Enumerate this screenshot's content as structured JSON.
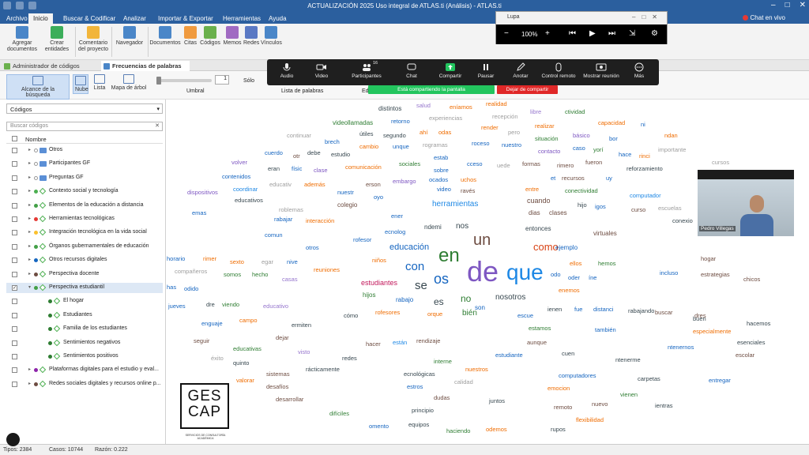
{
  "window": {
    "title": "ACTUALIZACIÓN 2025 Uso integral de ATLAS.ti (Análisis) - ATLAS.ti",
    "live_chat": "Chat en vivo"
  },
  "ribbon_tabs": [
    {
      "label": "Archivo"
    },
    {
      "label": "Inicio"
    },
    {
      "label": "Buscar & Codificar"
    },
    {
      "label": "Analizar"
    },
    {
      "label": "Importar & Exportar"
    },
    {
      "label": "Herramientas"
    },
    {
      "label": "Ayuda"
    }
  ],
  "ribbon": {
    "add_docs": "Agregar documentos",
    "create_entities": "Crear entidades",
    "project_comment": "Comentario del proyecto",
    "navigator": "Navegador",
    "documents": "Documentos",
    "quotes": "Citas",
    "codes": "Códigos",
    "memos": "Memos",
    "networks": "Redes",
    "links": "Vínculos"
  },
  "doc_tabs": [
    {
      "label": "Administrador de códigos"
    },
    {
      "label": "Frecuencias de palabras"
    }
  ],
  "subtoolbar": {
    "search_scope": "Alcance de la búsqueda",
    "cloud": "Nube",
    "list": "Lista",
    "tree_map": "Mapa de árbol",
    "threshold": "Umbral",
    "threshold_value": "1",
    "only": "Sólo",
    "word_list": "Lista de palabras",
    "partial_ed": "Ed"
  },
  "left_panel": {
    "dropdown": "Códigos",
    "search_placeholder": "Buscar códigos",
    "column_name": "Nombre",
    "items": [
      {
        "label": "Otros",
        "kind": "folder",
        "indent": 0
      },
      {
        "label": "Participantes GF",
        "kind": "folder",
        "indent": 0
      },
      {
        "label": "Preguntas GF",
        "kind": "folder",
        "indent": 0
      },
      {
        "label": "Contexto social y tecnología",
        "kind": "code",
        "indent": 0,
        "color": "#4caf50"
      },
      {
        "label": "Elementos de la educación a distancia",
        "kind": "code",
        "indent": 0,
        "color": "#43a047"
      },
      {
        "label": "Herramientas tecnológicas",
        "kind": "code",
        "indent": 0,
        "color": "#e53935"
      },
      {
        "label": "Integración tecnológica en la vida social",
        "kind": "code",
        "indent": 0,
        "color": "#fbc02d"
      },
      {
        "label": "Órganos gubernamentales de educación",
        "kind": "code",
        "indent": 0,
        "color": "#43a047"
      },
      {
        "label": "Otros recursos digitales",
        "kind": "code",
        "indent": 0,
        "color": "#1565c0"
      },
      {
        "label": "Perspectiva docente",
        "kind": "code",
        "indent": 0,
        "color": "#6d4c41"
      },
      {
        "label": "Perspectiva estudiantil",
        "kind": "code",
        "indent": 0,
        "color": "#43a047",
        "selected": true,
        "checked": true
      },
      {
        "label": "El hogar",
        "kind": "sub",
        "indent": 1,
        "color": "#2e7d32"
      },
      {
        "label": "Estudiantes",
        "kind": "sub",
        "indent": 1,
        "color": "#2e7d32"
      },
      {
        "label": "Familia de los estudiantes",
        "kind": "sub",
        "indent": 1,
        "color": "#2e7d32"
      },
      {
        "label": "Sentimientos negativos",
        "kind": "sub",
        "indent": 1,
        "color": "#2e7d32"
      },
      {
        "label": "Sentimientos positivos",
        "kind": "sub",
        "indent": 1,
        "color": "#2e7d32"
      },
      {
        "label": "Plataformas digitales para el estudio y eval...",
        "kind": "code",
        "indent": 0,
        "color": "#8e24aa"
      },
      {
        "label": "Redes sociales digitales y recursos online p...",
        "kind": "code",
        "indent": 0,
        "color": "#6d4c41"
      }
    ]
  },
  "zoom": {
    "audio": "Audio",
    "video": "Video",
    "participants": "Participantes",
    "participants_count": "16",
    "chat": "Chat",
    "share": "Compartir",
    "pause": "Pausar",
    "annotate": "Anotar",
    "remote": "Control remoto",
    "show_meeting": "Mostrar reunión",
    "more": "Más",
    "sharing_banner": "Está compartiendo la pantalla",
    "stop_sharing": "Dejar de compartir"
  },
  "magnifier": {
    "title": "Lupa",
    "zoom": "100%"
  },
  "webcam": {
    "name": "Pedro Villegas"
  },
  "logo": {
    "line1": "GES",
    "line2": "CAP",
    "subtitle": "SERVICIOS DE CONSULTORÍA ACADÉMICA"
  },
  "status": {
    "types": "Tipos: 2384",
    "cases": "Casos: 10744",
    "ratio": "Razón: 0.222"
  },
  "cloud_words": [
    {
      "t": "de",
      "s": 36,
      "c": "#7e57c2"
    },
    {
      "t": "que",
      "s": 28,
      "c": "#1e88e5"
    },
    {
      "t": "en",
      "s": 24,
      "c": "#2e7d32"
    },
    {
      "t": "un",
      "s": 20,
      "c": "#6d4c41"
    },
    {
      "t": "os",
      "s": 18,
      "c": "#1565c0"
    },
    {
      "t": "con",
      "s": 15,
      "c": "#1565c0"
    },
    {
      "t": "se",
      "s": 15,
      "c": "#37474f"
    },
    {
      "t": "como",
      "s": 13,
      "c": "#d84315"
    },
    {
      "t": "es",
      "s": 12,
      "c": "#37474f"
    },
    {
      "t": "no",
      "s": 12,
      "c": "#2e7d32"
    },
    {
      "t": "educación",
      "s": 11,
      "c": "#1565c0"
    },
    {
      "t": "herramientas",
      "s": 10,
      "c": "#1e88e5"
    },
    {
      "t": "nosotros",
      "s": 10,
      "c": "#37474f"
    },
    {
      "t": "estudiantes",
      "s": 9,
      "c": "#c2185b"
    },
    {
      "t": "bién",
      "s": 10,
      "c": "#2e7d32"
    },
    {
      "t": "distintos",
      "s": 8,
      "c": "#37474f"
    },
    {
      "t": "salud",
      "s": 7.5,
      "c": "#9575cd"
    },
    {
      "t": "eníamos",
      "s": 7.5,
      "c": "#ef6c00"
    },
    {
      "t": "realidad",
      "s": 7.5,
      "c": "#ef6c00"
    },
    {
      "t": "libre",
      "s": 7.5,
      "c": "#9575cd"
    },
    {
      "t": "ctividad",
      "s": 7.5,
      "c": "#2e7d32"
    },
    {
      "t": "videollamadas",
      "s": 8,
      "c": "#2e7d32"
    },
    {
      "t": "retorno",
      "s": 7.5,
      "c": "#1565c0"
    },
    {
      "t": "experiencias",
      "s": 7.5,
      "c": "#9e9e9e"
    },
    {
      "t": "recepción",
      "s": 7.5,
      "c": "#9e9e9e"
    },
    {
      "t": "realizar",
      "s": 7.5,
      "c": "#ef6c00"
    },
    {
      "t": "capacidad",
      "s": 7.5,
      "c": "#ef6c00"
    },
    {
      "t": "ni",
      "s": 7.5,
      "c": "#1565c0"
    },
    {
      "t": "útiles",
      "s": 7.5,
      "c": "#37474f"
    },
    {
      "t": "ahí",
      "s": 7.5,
      "c": "#ef6c00"
    },
    {
      "t": "odas",
      "s": 7.5,
      "c": "#ef6c00"
    },
    {
      "t": "render",
      "s": 7.5,
      "c": "#ef6c00"
    },
    {
      "t": "pero",
      "s": 7.5,
      "c": "#9e9e9e"
    },
    {
      "t": "básico",
      "s": 7.5,
      "c": "#7e57c2"
    },
    {
      "t": "ndan",
      "s": 7.5,
      "c": "#ef6c00"
    },
    {
      "t": "continuar",
      "s": 7.5,
      "c": "#9e9e9e"
    },
    {
      "t": "brech",
      "s": 7.5,
      "c": "#1565c0"
    },
    {
      "t": "segundo",
      "s": 7.5,
      "c": "#37474f"
    },
    {
      "t": "situación",
      "s": 7.5,
      "c": "#2e7d32"
    },
    {
      "t": "bor",
      "s": 7.5,
      "c": "#1565c0"
    },
    {
      "t": "cambio",
      "s": 7.5,
      "c": "#ef6c00"
    },
    {
      "t": "unque",
      "s": 7.5,
      "c": "#1565c0"
    },
    {
      "t": "rogramas",
      "s": 7.5,
      "c": "#9e9e9e"
    },
    {
      "t": "roceso",
      "s": 7.5,
      "c": "#1565c0"
    },
    {
      "t": "nuestro",
      "s": 7.5,
      "c": "#1565c0"
    },
    {
      "t": "contacto",
      "s": 7.5,
      "c": "#7e57c2"
    },
    {
      "t": "caso",
      "s": 7.5,
      "c": "#1565c0"
    },
    {
      "t": "yorí",
      "s": 7.5,
      "c": "#2e7d32"
    },
    {
      "t": "importante",
      "s": 7.5,
      "c": "#9e9e9e"
    },
    {
      "t": "cuerdo",
      "s": 7.5,
      "c": "#1565c0"
    },
    {
      "t": "otr",
      "s": 7.5,
      "c": "#6d4c41"
    },
    {
      "t": "debe",
      "s": 7.5,
      "c": "#37474f"
    },
    {
      "t": "estudio",
      "s": 7.5,
      "c": "#37474f"
    },
    {
      "t": "estab",
      "s": 7.5,
      "c": "#1565c0"
    },
    {
      "t": "hace",
      "s": 7.5,
      "c": "#1565c0"
    },
    {
      "t": "rinci",
      "s": 7.5,
      "c": "#ef6c00"
    },
    {
      "t": "volver",
      "s": 7.5,
      "c": "#7e57c2"
    },
    {
      "t": "eran",
      "s": 7.5,
      "c": "#37474f"
    },
    {
      "t": "físic",
      "s": 7.5,
      "c": "#1565c0"
    },
    {
      "t": "clase",
      "s": 7.5,
      "c": "#7e57c2"
    },
    {
      "t": "comunicación",
      "s": 7.5,
      "c": "#ef6c00"
    },
    {
      "t": "sociales",
      "s": 7.5,
      "c": "#2e7d32"
    },
    {
      "t": "sobre",
      "s": 7.5,
      "c": "#1565c0"
    },
    {
      "t": "cceso",
      "s": 7.5,
      "c": "#1565c0"
    },
    {
      "t": "uede",
      "s": 7.5,
      "c": "#9e9e9e"
    },
    {
      "t": "formas",
      "s": 7.5,
      "c": "#6d4c41"
    },
    {
      "t": "rimero",
      "s": 7.5,
      "c": "#6d4c41"
    },
    {
      "t": "fueron",
      "s": 7.5,
      "c": "#6d4c41"
    },
    {
      "t": "reforzamiento",
      "s": 7.5,
      "c": "#37474f"
    },
    {
      "t": "cursos",
      "s": 7.5,
      "c": "#9e9e9e"
    },
    {
      "t": "contenidos",
      "s": 7.5,
      "c": "#1565c0"
    },
    {
      "t": "educativ",
      "s": 7.5,
      "c": "#9e9e9e"
    },
    {
      "t": "además",
      "s": 7.5,
      "c": "#ef6c00"
    },
    {
      "t": "erson",
      "s": 7.5,
      "c": "#6d4c41"
    },
    {
      "t": "embargo",
      "s": 7.5,
      "c": "#7e57c2"
    },
    {
      "t": "ocados",
      "s": 7.5,
      "c": "#1565c0"
    },
    {
      "t": "uchos",
      "s": 7.5,
      "c": "#ef6c00"
    },
    {
      "t": "et",
      "s": 7.5,
      "c": "#1565c0"
    },
    {
      "t": "recursos",
      "s": 7.5,
      "c": "#6d4c41"
    },
    {
      "t": "uy",
      "s": 7.5,
      "c": "#1565c0"
    },
    {
      "t": "coordinar",
      "s": 7.5,
      "c": "#1e88e5"
    },
    {
      "t": "dispositivos",
      "s": 7.5,
      "c": "#7e57c2"
    },
    {
      "t": "nuestr",
      "s": 7.5,
      "c": "#1565c0"
    },
    {
      "t": "video",
      "s": 7.5,
      "c": "#1565c0"
    },
    {
      "t": "ravés",
      "s": 7.5,
      "c": "#6d4c41"
    },
    {
      "t": "entre",
      "s": 7.5,
      "c": "#ef6c00"
    },
    {
      "t": "conectividad",
      "s": 7.5,
      "c": "#2e7d32"
    },
    {
      "t": "computador",
      "s": 7.5,
      "c": "#1e88e5"
    },
    {
      "t": "educativos",
      "s": 7.5,
      "c": "#37474f"
    },
    {
      "t": "oyo",
      "s": 7.5,
      "c": "#1565c0"
    },
    {
      "t": "cuando",
      "s": 9,
      "c": "#6d4c41"
    },
    {
      "t": "hijo",
      "s": 7.5,
      "c": "#37474f"
    },
    {
      "t": "igos",
      "s": 7.5,
      "c": "#1565c0"
    },
    {
      "t": "escuelas",
      "s": 7.5,
      "c": "#9e9e9e"
    },
    {
      "t": "emas",
      "s": 7.5,
      "c": "#1565c0"
    },
    {
      "t": "roblemas",
      "s": 7.5,
      "c": "#9e9e9e"
    },
    {
      "t": "colegio",
      "s": 8,
      "c": "#6d4c41"
    },
    {
      "t": "ener",
      "s": 7.5,
      "c": "#1565c0"
    },
    {
      "t": "dias",
      "s": 8,
      "c": "#6d4c41"
    },
    {
      "t": "clases",
      "s": 8,
      "c": "#6d4c41"
    },
    {
      "t": "curso",
      "s": 7.5,
      "c": "#6d4c41"
    },
    {
      "t": "conexio",
      "s": 7.5,
      "c": "#37474f"
    },
    {
      "t": "rabajar",
      "s": 7.5,
      "c": "#1565c0"
    },
    {
      "t": "interacción",
      "s": 7.5,
      "c": "#ef6c00"
    },
    {
      "t": "ndemi",
      "s": 8,
      "c": "#37474f"
    },
    {
      "t": "nos",
      "s": 10,
      "c": "#37474f"
    },
    {
      "t": "entonces",
      "s": 8,
      "c": "#37474f"
    },
    {
      "t": "virtuales",
      "s": 8,
      "c": "#6d4c41"
    },
    {
      "t": "ejemplo",
      "s": 8,
      "c": "#1565c0"
    },
    {
      "t": "ecnolog",
      "s": 7.5,
      "c": "#1565c0"
    },
    {
      "t": "rofesor",
      "s": 7.5,
      "c": "#1565c0"
    },
    {
      "t": "comun",
      "s": 7.5,
      "c": "#1565c0"
    },
    {
      "t": "otros",
      "s": 7.5,
      "c": "#1565c0"
    },
    {
      "t": "niños",
      "s": 7.5,
      "c": "#ef6c00"
    },
    {
      "t": "ellos",
      "s": 7.5,
      "c": "#ef6c00"
    },
    {
      "t": "hemos",
      "s": 7.5,
      "c": "#2e7d32"
    },
    {
      "t": "incluso",
      "s": 7.5,
      "c": "#1565c0"
    },
    {
      "t": "hogar",
      "s": 7.5,
      "c": "#6d4c41"
    },
    {
      "t": "horario",
      "s": 7.5,
      "c": "#1565c0"
    },
    {
      "t": "rimer",
      "s": 7.5,
      "c": "#ef6c00"
    },
    {
      "t": "sexto",
      "s": 7.5,
      "c": "#ef6c00"
    },
    {
      "t": "egar",
      "s": 7.5,
      "c": "#9e9e9e"
    },
    {
      "t": "nive",
      "s": 7.5,
      "c": "#1565c0"
    },
    {
      "t": "reuniones",
      "s": 7.5,
      "c": "#ef6c00"
    },
    {
      "t": "odo",
      "s": 7.5,
      "c": "#1565c0"
    },
    {
      "t": "oder",
      "s": 7.5,
      "c": "#1565c0"
    },
    {
      "t": "íne",
      "s": 7.5,
      "c": "#1565c0"
    },
    {
      "t": "estrategias",
      "s": 7.5,
      "c": "#6d4c41"
    },
    {
      "t": "chicos",
      "s": 7.5,
      "c": "#6d4c41"
    },
    {
      "t": "compañeros",
      "s": 7.5,
      "c": "#9e9e9e"
    },
    {
      "t": "somos",
      "s": 7.5,
      "c": "#2e7d32"
    },
    {
      "t": "hecho",
      "s": 7.5,
      "c": "#2e7d32"
    },
    {
      "t": "casas",
      "s": 7.5,
      "c": "#9575cd"
    },
    {
      "t": "odido",
      "s": 7.5,
      "c": "#1565c0"
    },
    {
      "t": "has",
      "s": 7.5,
      "c": "#1565c0"
    },
    {
      "t": "hijos",
      "s": 8,
      "c": "#2e7d32"
    },
    {
      "t": "enemos",
      "s": 7.5,
      "c": "#ef6c00"
    },
    {
      "t": "rabajo",
      "s": 8,
      "c": "#1565c0"
    },
    {
      "t": "rabajando",
      "s": 7.5,
      "c": "#37474f"
    },
    {
      "t": "jueves",
      "s": 7.5,
      "c": "#1565c0"
    },
    {
      "t": "dre",
      "s": 7.5,
      "c": "#37474f"
    },
    {
      "t": "viendo",
      "s": 7.5,
      "c": "#2e7d32"
    },
    {
      "t": "educativo",
      "s": 7.5,
      "c": "#9575cd"
    },
    {
      "t": "cómo",
      "s": 7.5,
      "c": "#37474f"
    },
    {
      "t": "rofesores",
      "s": 7.5,
      "c": "#ef6c00"
    },
    {
      "t": "orque",
      "s": 7.5,
      "c": "#ef6c00"
    },
    {
      "t": "son",
      "s": 8,
      "c": "#1565c0"
    },
    {
      "t": "escue",
      "s": 7.5,
      "c": "#1565c0"
    },
    {
      "t": "ienen",
      "s": 7.5,
      "c": "#37474f"
    },
    {
      "t": "fue",
      "s": 7.5,
      "c": "#1565c0"
    },
    {
      "t": "distanci",
      "s": 7.5,
      "c": "#1565c0"
    },
    {
      "t": "buscar",
      "s": 7.5,
      "c": "#6d4c41"
    },
    {
      "t": "dres",
      "s": 7.5,
      "c": "#6d4c41"
    },
    {
      "t": "buen",
      "s": 7.5,
      "c": "#37474f"
    },
    {
      "t": "hacemos",
      "s": 7.5,
      "c": "#37474f"
    },
    {
      "t": "enguaje",
      "s": 7.5,
      "c": "#1565c0"
    },
    {
      "t": "campo",
      "s": 7.5,
      "c": "#ef6c00"
    },
    {
      "t": "ermiten",
      "s": 7.5,
      "c": "#37474f"
    },
    {
      "t": "estamos",
      "s": 7.5,
      "c": "#2e7d32"
    },
    {
      "t": "también",
      "s": 7.5,
      "c": "#1565c0"
    },
    {
      "t": "especialmente",
      "s": 7.5,
      "c": "#ef6c00"
    },
    {
      "t": "seguir",
      "s": 7.5,
      "c": "#6d4c41"
    },
    {
      "t": "dejar",
      "s": 7.5,
      "c": "#6d4c41"
    },
    {
      "t": "rendizaje",
      "s": 7.5,
      "c": "#6d4c41"
    },
    {
      "t": "aunque",
      "s": 7.5,
      "c": "#6d4c41"
    },
    {
      "t": "ntenernos",
      "s": 7.5,
      "c": "#1565c0"
    },
    {
      "t": "esenciales",
      "s": 7.5,
      "c": "#37474f"
    },
    {
      "t": "educativas",
      "s": 7.5,
      "c": "#2e7d32"
    },
    {
      "t": "visto",
      "s": 7.5,
      "c": "#9575cd"
    },
    {
      "t": "hacer",
      "s": 7.5,
      "c": "#6d4c41"
    },
    {
      "t": "están",
      "s": 7.5,
      "c": "#1e88e5"
    },
    {
      "t": "estudiante",
      "s": 7.5,
      "c": "#1565c0"
    },
    {
      "t": "cuen",
      "s": 7.5,
      "c": "#37474f"
    },
    {
      "t": "escolar",
      "s": 7.5,
      "c": "#6d4c41"
    },
    {
      "t": "éxito",
      "s": 7.5,
      "c": "#9e9e9e"
    },
    {
      "t": "quinto",
      "s": 7.5,
      "c": "#37474f"
    },
    {
      "t": "redes",
      "s": 7.5,
      "c": "#37474f"
    },
    {
      "t": "interne",
      "s": 7.5,
      "c": "#2e7d32"
    },
    {
      "t": "ntenerme",
      "s": 7.5,
      "c": "#37474f"
    },
    {
      "t": "sistemas",
      "s": 7.5,
      "c": "#6d4c41"
    },
    {
      "t": "rácticamente",
      "s": 7.5,
      "c": "#37474f"
    },
    {
      "t": "ecnológicas",
      "s": 7.5,
      "c": "#37474f"
    },
    {
      "t": "nuestros",
      "s": 7.5,
      "c": "#ef6c00"
    },
    {
      "t": "computadores",
      "s": 7.5,
      "c": "#1565c0"
    },
    {
      "t": "carpetas",
      "s": 7.5,
      "c": "#37474f"
    },
    {
      "t": "entregar",
      "s": 7.5,
      "c": "#1565c0"
    },
    {
      "t": "valorar",
      "s": 7.5,
      "c": "#ef6c00"
    },
    {
      "t": "desafíos",
      "s": 7.5,
      "c": "#6d4c41"
    },
    {
      "t": "estros",
      "s": 7.5,
      "c": "#1565c0"
    },
    {
      "t": "calidad",
      "s": 7.5,
      "c": "#9e9e9e"
    },
    {
      "t": "emocion",
      "s": 7.5,
      "c": "#ef6c00"
    },
    {
      "t": "vienen",
      "s": 7.5,
      "c": "#2e7d32"
    },
    {
      "t": "desarrollar",
      "s": 7.5,
      "c": "#6d4c41"
    },
    {
      "t": "dudas",
      "s": 7.5,
      "c": "#6d4c41"
    },
    {
      "t": "juntos",
      "s": 7.5,
      "c": "#37474f"
    },
    {
      "t": "remoto",
      "s": 7.5,
      "c": "#6d4c41"
    },
    {
      "t": "nuevo",
      "s": 7.5,
      "c": "#6d4c41"
    },
    {
      "t": "ientras",
      "s": 7.5,
      "c": "#37474f"
    },
    {
      "t": "difíciles",
      "s": 7.5,
      "c": "#2e7d32"
    },
    {
      "t": "principio",
      "s": 7.5,
      "c": "#37474f"
    },
    {
      "t": "flexibilidad",
      "s": 7.5,
      "c": "#ef6c00"
    },
    {
      "t": "omento",
      "s": 7.5,
      "c": "#1565c0"
    },
    {
      "t": "equipos",
      "s": 7.5,
      "c": "#37474f"
    },
    {
      "t": "haciendo",
      "s": 7.5,
      "c": "#2e7d32"
    },
    {
      "t": "odemos",
      "s": 7.5,
      "c": "#ef6c00"
    },
    {
      "t": "rupos",
      "s": 7.5,
      "c": "#37474f"
    }
  ]
}
